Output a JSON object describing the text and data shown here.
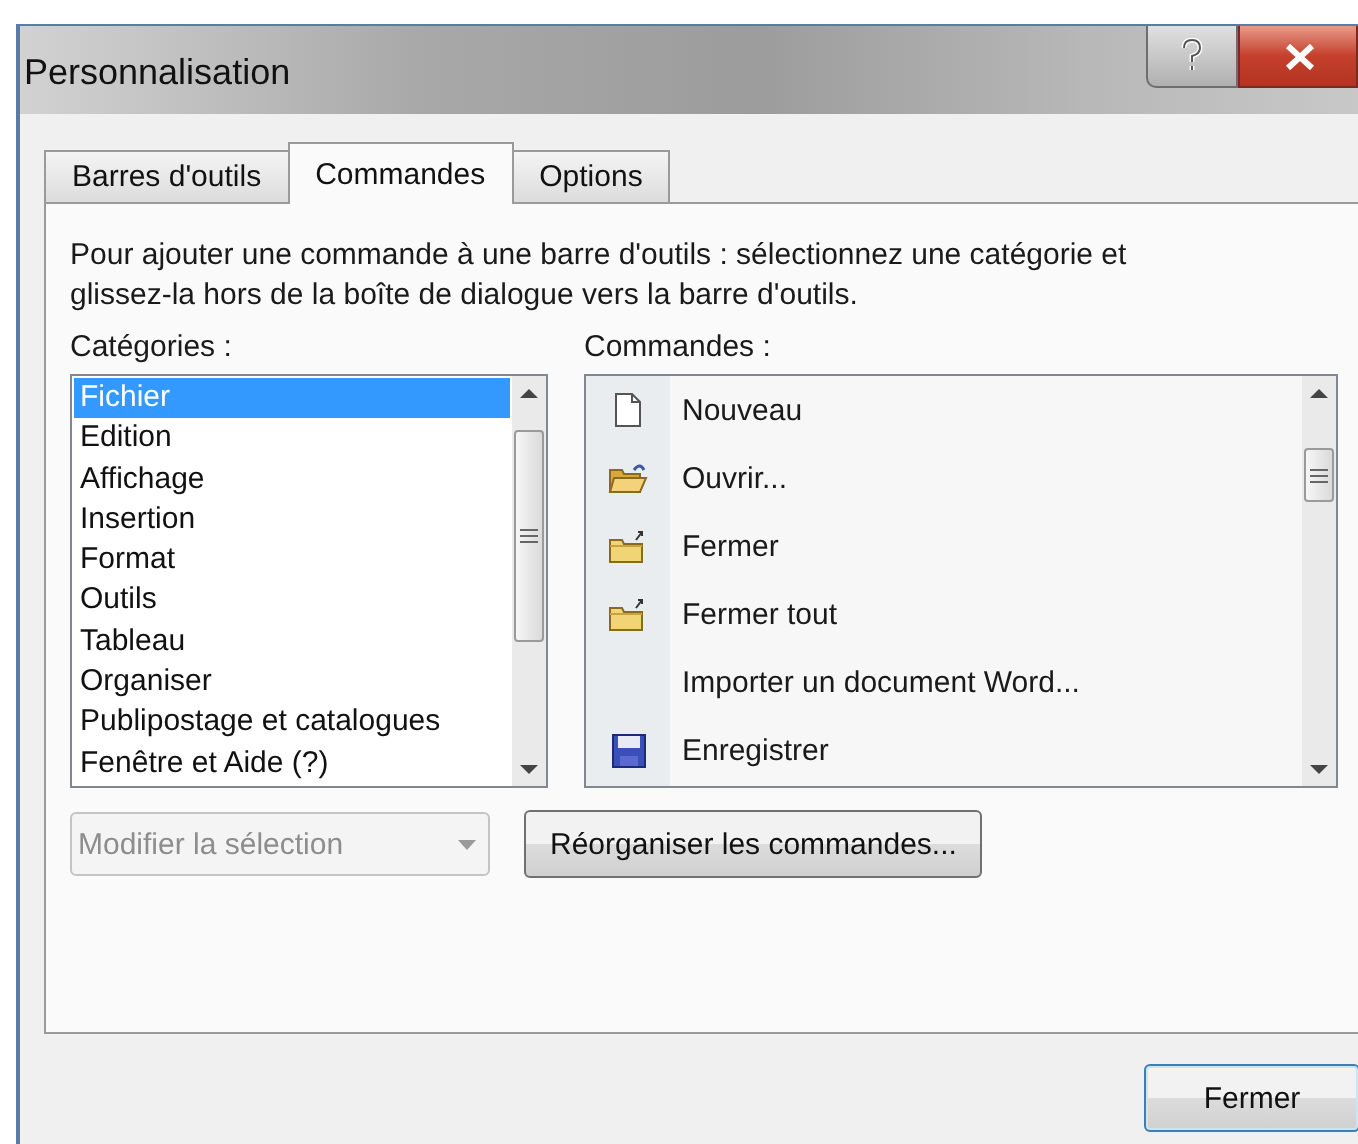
{
  "window": {
    "title": "Personnalisation"
  },
  "tabs": [
    {
      "label": "Barres d'outils",
      "selected": false
    },
    {
      "label": "Commandes",
      "selected": true
    },
    {
      "label": "Options",
      "selected": false
    }
  ],
  "instructions": "Pour ajouter une commande à une barre d'outils : sélectionnez une catégorie et glissez-la hors de la boîte de dialogue vers la barre d'outils.",
  "categories": {
    "label": "Catégories :",
    "items": [
      {
        "label": "Fichier",
        "selected": true
      },
      {
        "label": "Edition",
        "selected": false
      },
      {
        "label": "Affichage",
        "selected": false
      },
      {
        "label": "Insertion",
        "selected": false
      },
      {
        "label": "Format",
        "selected": false
      },
      {
        "label": "Outils",
        "selected": false
      },
      {
        "label": "Tableau",
        "selected": false
      },
      {
        "label": "Organiser",
        "selected": false
      },
      {
        "label": "Publipostage et catalogues",
        "selected": false
      },
      {
        "label": "Fenêtre et Aide (?)",
        "selected": false
      }
    ]
  },
  "commands": {
    "label": "Commandes :",
    "items": [
      {
        "label": "Nouveau",
        "kind": "page"
      },
      {
        "label": "Ouvrir...",
        "kind": "open-folder"
      },
      {
        "label": "Fermer",
        "kind": "folder"
      },
      {
        "label": "Fermer tout",
        "kind": "folder"
      },
      {
        "label": "Importer un document Word...",
        "kind": "plain"
      },
      {
        "label": "Enregistrer",
        "kind": "floppy"
      }
    ]
  },
  "selection_menu": {
    "value": "Modifier la sélection",
    "disabled": true
  },
  "rearrange_button": "Réorganiser les commandes...",
  "close_button": "Fermer"
}
